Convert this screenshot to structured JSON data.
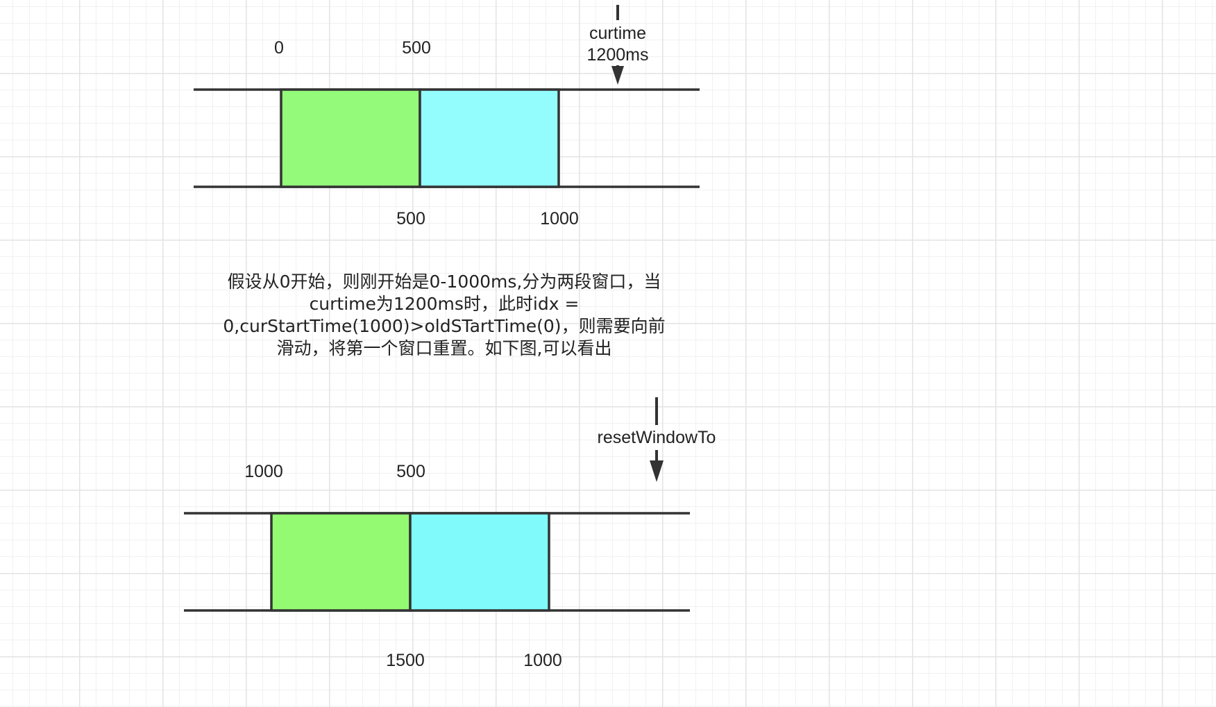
{
  "diagram": {
    "top": {
      "labels_above": [
        "0",
        "500"
      ],
      "labels_below": [
        "500",
        "1000"
      ],
      "pointer": {
        "line1": "curtime",
        "line2": "1200ms"
      }
    },
    "description": "假设从0开始，则刚开始是0-1000ms,分为两段窗口，当curtime为1200ms时，此时idx = 0,curStartTime(1000)>oldSTartTime(0)，则需要向前滑动，将第一个窗口重置。如下图,可以看出",
    "bottom": {
      "labels_above": [
        "1000",
        "500"
      ],
      "labels_below": [
        "1500",
        "1000"
      ],
      "pointer": {
        "label": "resetWindowTo"
      }
    }
  },
  "colors": {
    "window_a": "#93fa7a",
    "window_b": "#93fdfd",
    "window_a2": "#93fa72",
    "window_b2": "#80fafb",
    "stroke": "#333333"
  }
}
